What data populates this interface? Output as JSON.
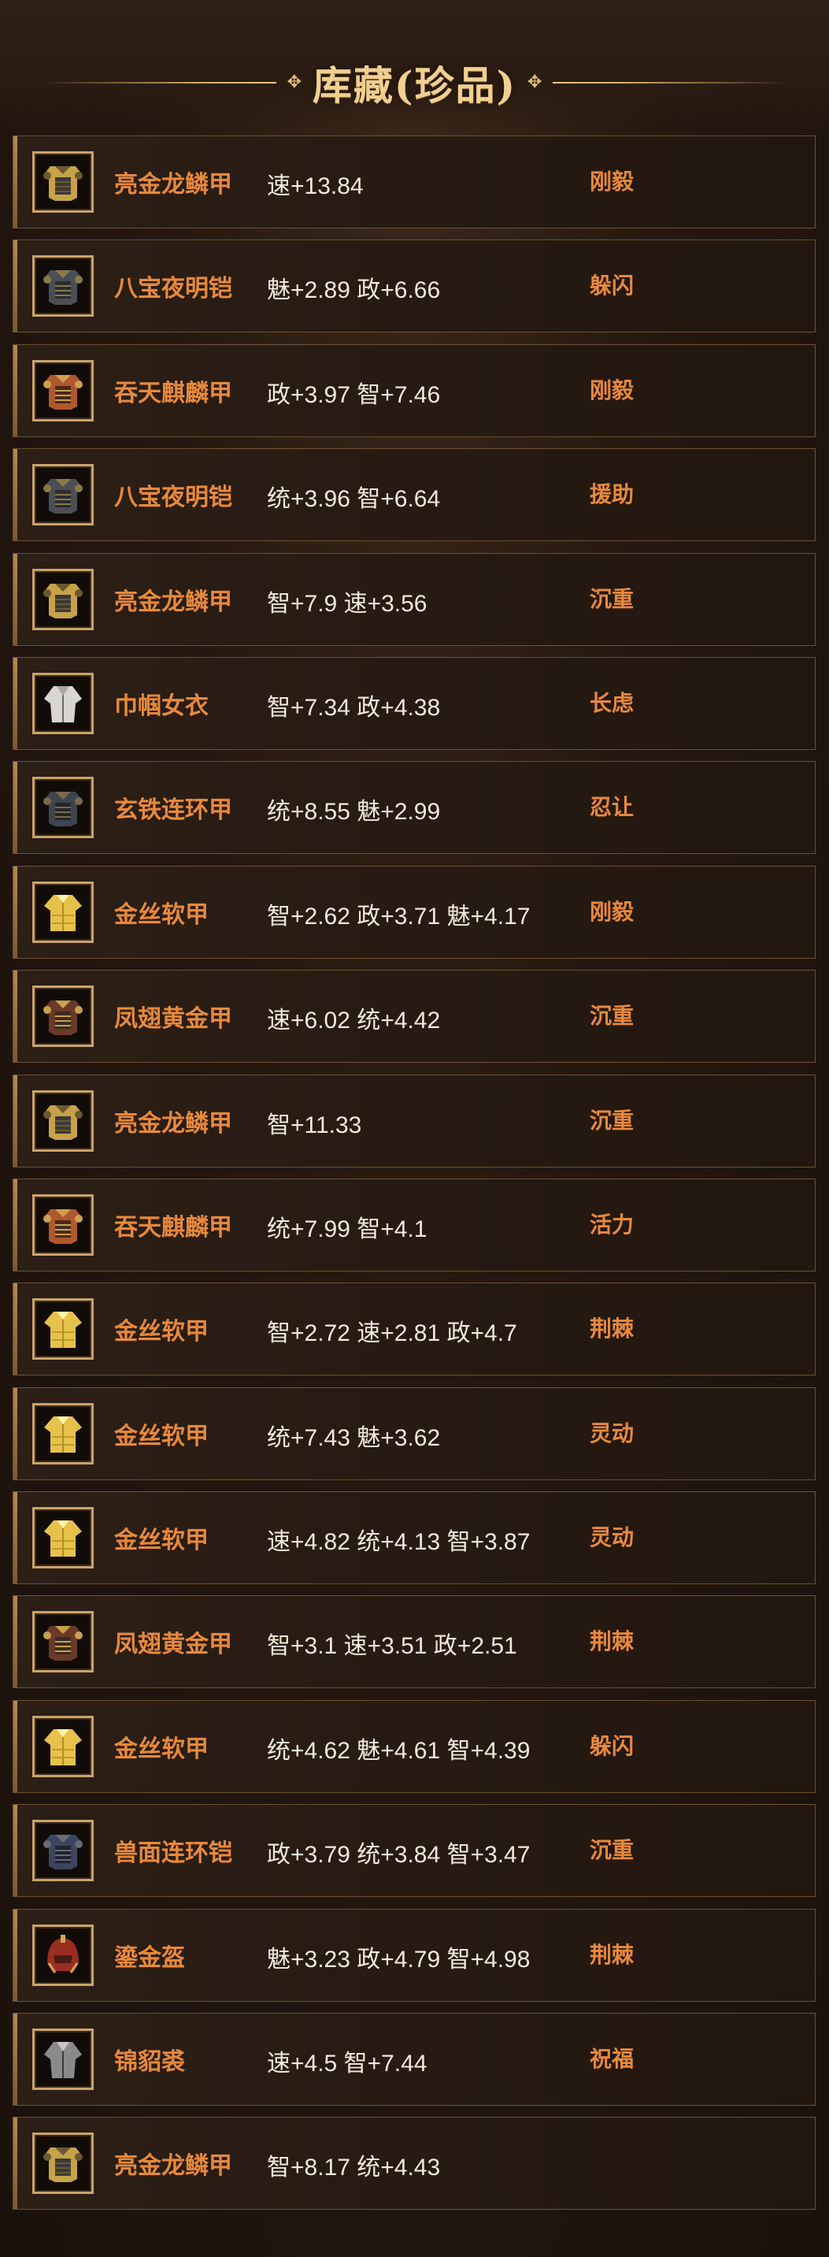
{
  "page": {
    "title": "库藏(珍品)"
  },
  "colors": {
    "name": "#e8893c",
    "trait": "#e8893c",
    "stats": "#f3eadb",
    "title": "#f1d08f"
  },
  "items": [
    {
      "name": "亮金龙鳞甲",
      "stats": "速+13.84",
      "trait": "刚毅",
      "icon": "gold-scale-armor-icon"
    },
    {
      "name": "八宝夜明铠",
      "stats": "魅+2.89 政+6.66",
      "trait": "躲闪",
      "icon": "dark-armor-icon"
    },
    {
      "name": "吞天麒麟甲",
      "stats": "政+3.97 智+7.46",
      "trait": "刚毅",
      "icon": "red-armor-icon"
    },
    {
      "name": "八宝夜明铠",
      "stats": "统+3.96 智+6.64",
      "trait": "援助",
      "icon": "dark-armor-icon"
    },
    {
      "name": "亮金龙鳞甲",
      "stats": "智+7.9 速+3.56",
      "trait": "沉重",
      "icon": "gold-scale-armor-icon"
    },
    {
      "name": "巾帼女衣",
      "stats": "智+7.34 政+4.38",
      "trait": "长虑",
      "icon": "white-robe-icon"
    },
    {
      "name": "玄铁连环甲",
      "stats": "统+8.55 魅+2.99",
      "trait": "忍让",
      "icon": "iron-chain-armor-icon"
    },
    {
      "name": "金丝软甲",
      "stats": "智+2.62 政+3.71 魅+4.17",
      "trait": "刚毅",
      "icon": "gold-silk-armor-icon"
    },
    {
      "name": "凤翅黄金甲",
      "stats": "速+6.02 统+4.42",
      "trait": "沉重",
      "icon": "phoenix-armor-icon"
    },
    {
      "name": "亮金龙鳞甲",
      "stats": "智+11.33",
      "trait": "沉重",
      "icon": "gold-scale-armor-icon"
    },
    {
      "name": "吞天麒麟甲",
      "stats": "统+7.99 智+4.1",
      "trait": "活力",
      "icon": "red-armor-icon"
    },
    {
      "name": "金丝软甲",
      "stats": "智+2.72 速+2.81 政+4.7",
      "trait": "荆棘",
      "icon": "gold-silk-armor-icon"
    },
    {
      "name": "金丝软甲",
      "stats": "统+7.43 魅+3.62",
      "trait": "灵动",
      "icon": "gold-silk-armor-icon"
    },
    {
      "name": "金丝软甲",
      "stats": "速+4.82 统+4.13 智+3.87",
      "trait": "灵动",
      "icon": "gold-silk-armor-icon"
    },
    {
      "name": "凤翅黄金甲",
      "stats": "智+3.1 速+3.51 政+2.51",
      "trait": "荆棘",
      "icon": "phoenix-armor-icon"
    },
    {
      "name": "金丝软甲",
      "stats": "统+4.62 魅+4.61 智+4.39",
      "trait": "躲闪",
      "icon": "gold-silk-armor-icon"
    },
    {
      "name": "兽面连环铠",
      "stats": "政+3.79 统+3.84 智+3.47",
      "trait": "沉重",
      "icon": "beast-chain-armor-icon"
    },
    {
      "name": "鎏金盔",
      "stats": "魅+3.23 政+4.79 智+4.98",
      "trait": "荆棘",
      "icon": "gilded-helmet-icon"
    },
    {
      "name": "锦貂裘",
      "stats": "速+4.5 智+7.44",
      "trait": "祝福",
      "icon": "fur-coat-icon"
    },
    {
      "name": "亮金龙鳞甲",
      "stats": "智+8.17 统+4.43",
      "trait": "",
      "icon": "gold-scale-armor-icon"
    }
  ]
}
